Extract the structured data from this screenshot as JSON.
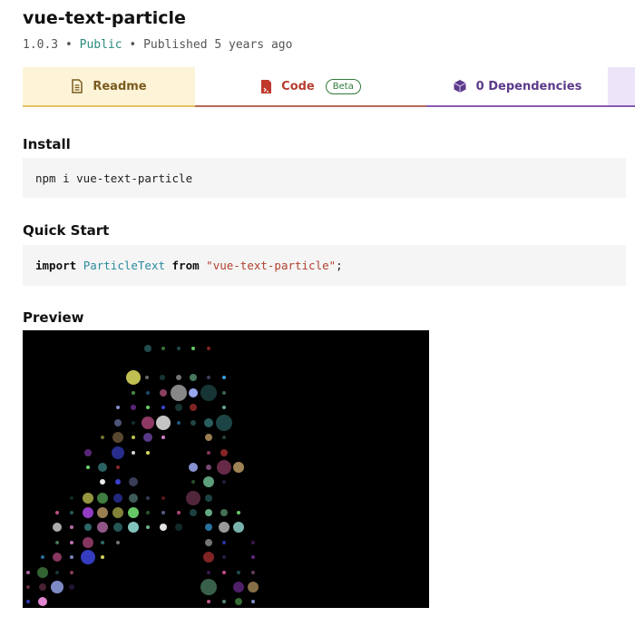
{
  "package": {
    "name": "vue-text-particle",
    "version": "1.0.3",
    "sep": "•",
    "visibility": "Public",
    "published": "Published 5 years ago"
  },
  "tabs": [
    {
      "label": "Readme",
      "icon": "file-text-icon"
    },
    {
      "label": "Code",
      "icon": "code-file-icon",
      "badge": "Beta"
    },
    {
      "label": "0 Dependencies",
      "icon": "cube-icon"
    }
  ],
  "install": {
    "heading": "Install",
    "command": "npm i vue-text-particle"
  },
  "quick_start": {
    "heading": "Quick Start",
    "kw_import": "import",
    "ident": "ParticleText",
    "kw_from": "from",
    "module": "\"vue-text-particle\"",
    "semi": ";"
  },
  "preview": {
    "heading": "Preview",
    "image": "particle-text-preview"
  },
  "colors": {
    "readme_bg": "#fdf4d8",
    "code_accent": "#b73d2f",
    "deps_accent": "#5b3a8a",
    "public": "#2b8a7e"
  }
}
